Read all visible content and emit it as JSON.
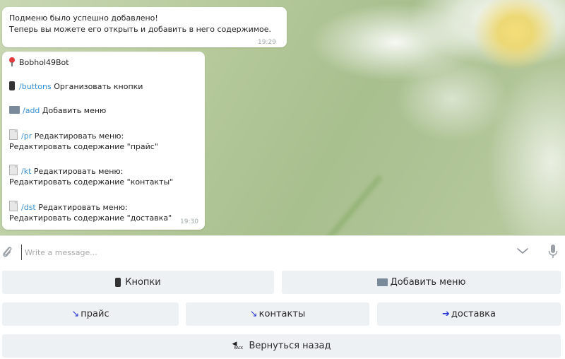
{
  "chat": {
    "message1": {
      "line1": "Подменю было успешно добавлено!",
      "line2": "Теперь вы можете его открыть и добавить в него содержимое.",
      "time": "19:29"
    },
    "message2": {
      "title": "Bobhol49Bot",
      "items": [
        {
          "cmd": "/buttons",
          "text": " Организовать кнопки",
          "icon": "phone-icon"
        },
        {
          "cmd": "/add",
          "text": " Добавить меню",
          "icon": "folder-icon"
        },
        {
          "cmd": "/pr",
          "text": " Редактировать меню:",
          "sub": "Редактировать содержание \"прайс\"",
          "icon": "document-icon"
        },
        {
          "cmd": "/kt",
          "text": " Редактировать меню:",
          "sub": "Редактировать содержание \"контакты\"",
          "icon": "document-icon"
        },
        {
          "cmd": "/dst",
          "text": " Редактировать меню:",
          "sub": "Редактировать содержание \"доставка\"",
          "icon": "document-icon"
        }
      ],
      "time": "19:30"
    }
  },
  "input": {
    "placeholder": "Write a message..."
  },
  "keyboard": {
    "row1": [
      {
        "label": "Кнопки",
        "icon": "phone-icon"
      },
      {
        "label": "Добавить меню",
        "icon": "folder-icon"
      }
    ],
    "row2": [
      {
        "label": "прайс",
        "icon": "arrow-icon"
      },
      {
        "label": "контакты",
        "icon": "arrow-icon"
      },
      {
        "label": "доставка",
        "icon": "arrow-icon"
      }
    ],
    "row3": [
      {
        "label": "Вернуться назад",
        "icon": "back-icon"
      }
    ]
  },
  "colors": {
    "link": "#3a8fd2",
    "button_bg": "#eef1f3",
    "arrow": "#2b3bd6"
  }
}
